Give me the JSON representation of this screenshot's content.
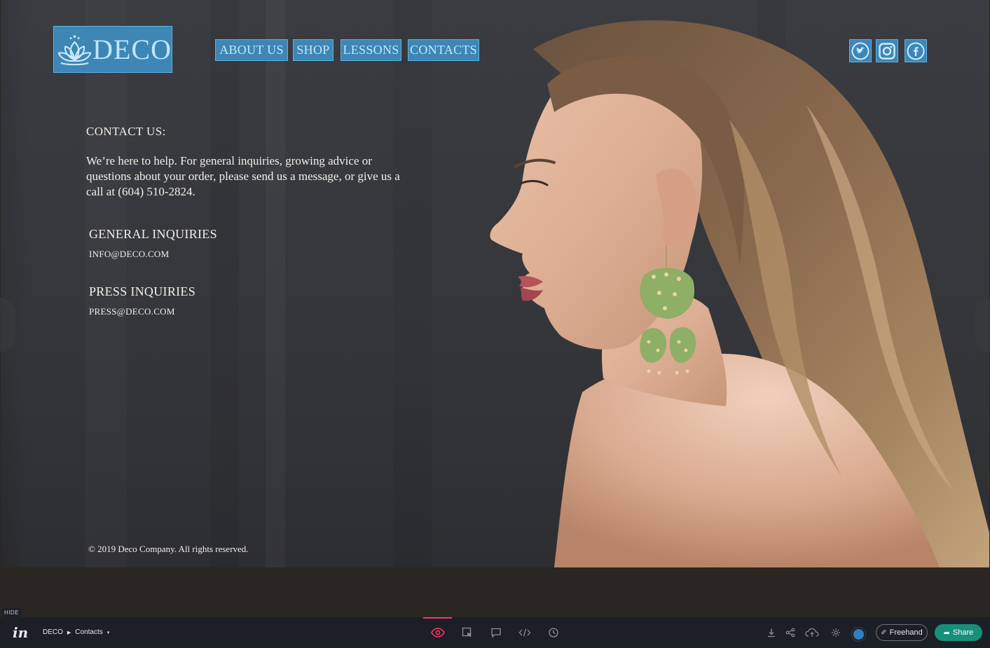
{
  "site": {
    "logo_text": "DECO",
    "nav": [
      {
        "label": "ABOUT US"
      },
      {
        "label": "SHOP"
      },
      {
        "label": "LESSONS"
      },
      {
        "label": "CONTACTS"
      }
    ],
    "social": [
      {
        "icon": "twitter-icon"
      },
      {
        "icon": "instagram-icon"
      },
      {
        "icon": "facebook-icon"
      }
    ],
    "brand_color": "#3d86b5",
    "brand_border_color": "#5fb3e6"
  },
  "contact": {
    "heading": "CONTACT US:",
    "body": "We’re here to help. For general inquiries, growing advice or questions about your order, please send us a message, or give us a call at (604) 510-2824.",
    "general_title": "GENERAL INQUIRIES",
    "general_email": "INFO@DECO.COM",
    "press_title": "PRESS INQUIRIES",
    "press_email": "PRESS@DECO.COM"
  },
  "footer": {
    "copyright": "© 2019 Deco Company. All rights reserved."
  },
  "toolbar": {
    "hide_label": "HIDE",
    "brand": "in",
    "project": "DECO",
    "screen": "Contacts",
    "freehand_label": "Freehand",
    "share_label": "Share",
    "active_mode": "preview",
    "accent_color": "#ff3366",
    "share_color": "#17907a"
  }
}
